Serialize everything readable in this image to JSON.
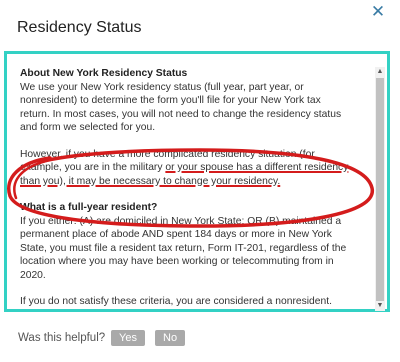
{
  "dialog": {
    "title": "Residency Status",
    "close_symbol": "✕",
    "close_icon": "close-icon"
  },
  "content": {
    "heading1": "About New York Residency Status",
    "para1": [
      "We use your New York residency status (full year, part year, or",
      "nonresident) to determine the form you'll file for your New York tax",
      "return. In most cases, you will not need to change the residency status",
      "and form we selected for you."
    ],
    "para2_lines": [
      [
        "However, if you have a more complicated residency situation (for"
      ],
      [
        "example, you are in the military ",
        "or your spouse has a different residency"
      ],
      [
        "than you)",
        ", it may be necessary to change your residency."
      ]
    ],
    "heading2": "What is a full-year resident?",
    "para3": [
      "If you either: (A) are domiciled in New York State; OR (B) maintained a",
      "permanent place of abode AND spent 184 days or more in New York",
      "State, you must file a resident tax return, Form IT-201, regardless of the",
      "location where you may have been working or telecommuting from in",
      "2020."
    ],
    "para4": "If you do not satisfy these criteria, you are considered a nonresident."
  },
  "footer": {
    "helpful_label": "Was this helpful?",
    "yes_label": "Yes",
    "no_label": "No"
  },
  "colors": {
    "frame": "#33d1c4",
    "annotation": "#d41c1c",
    "button": "#a9a9a9",
    "close": "#3a7ca5"
  },
  "icons": {
    "scroll_up": "▲",
    "scroll_down": "▼"
  }
}
